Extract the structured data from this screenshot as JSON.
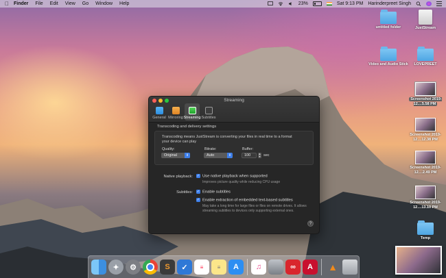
{
  "menubar": {
    "app": "Finder",
    "items": [
      "File",
      "Edit",
      "View",
      "Go",
      "Window",
      "Help"
    ],
    "battery": "23%",
    "clock": "Sat 9:13 PM",
    "user": "Harinderpreet Singh"
  },
  "desktop": {
    "icons": [
      {
        "label": "untitled folder",
        "type": "folder"
      },
      {
        "label": "JustStream",
        "type": "drive"
      },
      {
        "label": "Video and Audio Stick",
        "type": "folder"
      },
      {
        "label": "LOVEPREET",
        "type": "folder"
      },
      {
        "label": "Screenshot 2019-12....5.58 PM",
        "type": "screenshot"
      },
      {
        "label": "Screenshot 2019-12....12.38 PM",
        "type": "screenshot"
      },
      {
        "label": "Screenshot 2019-12....2.49 PM",
        "type": "screenshot"
      },
      {
        "label": "Screenshot 2019-12....13.10 PM",
        "type": "screenshot"
      },
      {
        "label": "Temp",
        "type": "folder"
      }
    ]
  },
  "window": {
    "title": "Streaming",
    "tabs": [
      {
        "label": "General",
        "icon": "general-icon"
      },
      {
        "label": "Mirroring",
        "icon": "mirroring-icon"
      },
      {
        "label": "Streaming",
        "icon": "streaming-icon"
      },
      {
        "label": "Subtitles",
        "icon": "subtitles-icon"
      }
    ],
    "transcoding": {
      "section_title": "Transcoding and delivery settings",
      "description": "Transcoding means JustStream is converting your files in real time to a format your device can play",
      "quality_label": "Quality:",
      "quality_value": "Original",
      "bitrate_label": "Bitrate:",
      "bitrate_value": "Auto",
      "buffer_label": "Buffer:",
      "buffer_value": "100",
      "buffer_unit": "sec"
    },
    "native_playback": {
      "label": "Native playback:",
      "option": "Use native playback when supported",
      "hint": "Improves picture quality while reducing CPU usage"
    },
    "subtitles": {
      "label": "Subtitles:",
      "option1": "Enable subtitles",
      "option2": "Enable extraction of embedded text-based subtitles",
      "hint": "May take a long time for large files or files on remote drives. It allows streaming subtitles to devices only supporting external ones."
    },
    "help": "?"
  },
  "dock": {
    "apps": [
      "Finder",
      "Launchpad",
      "System Preferences",
      "Chrome",
      "Sublime Text",
      "Wunderlist",
      "Reminders",
      "Notes",
      "App Store",
      "iTunes",
      "Image Capture",
      "Creative Cloud",
      "Acrobat",
      "VLC",
      "Trash"
    ]
  }
}
